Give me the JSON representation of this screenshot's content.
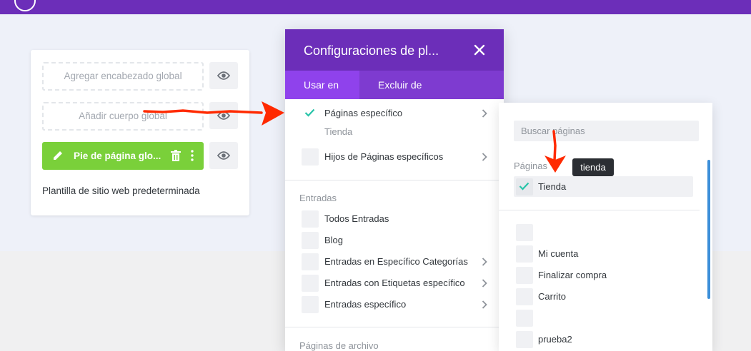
{
  "colors": {
    "brand_purple": "#6c2eb9",
    "tab_bar": "#7e3bd0",
    "tab_active": "#8f42ec",
    "footer_green": "#7ad03a",
    "check_teal": "#29c4a9",
    "annotation_red": "#ff2a00",
    "scroll_blue": "#3c8fd9"
  },
  "template_card": {
    "header_slot": "Agregar encabezado global",
    "body_slot": "Añadir cuerpo global",
    "footer_slot": "Pie de página glo...",
    "template_name": "Plantilla de sitio web predeterminada",
    "icons": [
      "pencil-icon",
      "trash-icon",
      "more-vertical-icon",
      "eye-icon"
    ]
  },
  "modal": {
    "title": "Configuraciones de pl...",
    "tabs": [
      {
        "label": "Usar en",
        "active": true
      },
      {
        "label": "Excluir de",
        "active": false
      }
    ],
    "items": [
      {
        "label": "Páginas específico",
        "checked": true,
        "has_chevron": true,
        "sub_label": "Tienda"
      },
      {
        "label": "Hijos de Páginas específicos",
        "checked": false,
        "has_chevron": true
      }
    ],
    "sections": [
      {
        "title": "Entradas",
        "items": [
          {
            "label": "Todos Entradas",
            "checked": false,
            "has_chevron": false
          },
          {
            "label": "Blog",
            "checked": false,
            "has_chevron": false
          },
          {
            "label": "Entradas en Específico Categorías",
            "checked": false,
            "has_chevron": true
          },
          {
            "label": "Entradas con Etiquetas específico",
            "checked": false,
            "has_chevron": true
          },
          {
            "label": "Entradas específico",
            "checked": false,
            "has_chevron": true
          }
        ]
      },
      {
        "title": "Páginas de archivo",
        "items": []
      }
    ]
  },
  "side_panel": {
    "search_placeholder": "Buscar páginas",
    "section_title": "Páginas",
    "tooltip": "tienda",
    "selected": {
      "label": "Tienda",
      "checked": true
    },
    "items": [
      {
        "label": "",
        "checked": false
      },
      {
        "label": "Mi cuenta",
        "checked": false
      },
      {
        "label": "Finalizar compra",
        "checked": false
      },
      {
        "label": "Carrito",
        "checked": false
      },
      {
        "label": "",
        "checked": false
      },
      {
        "label": "prueba2",
        "checked": false
      }
    ]
  }
}
